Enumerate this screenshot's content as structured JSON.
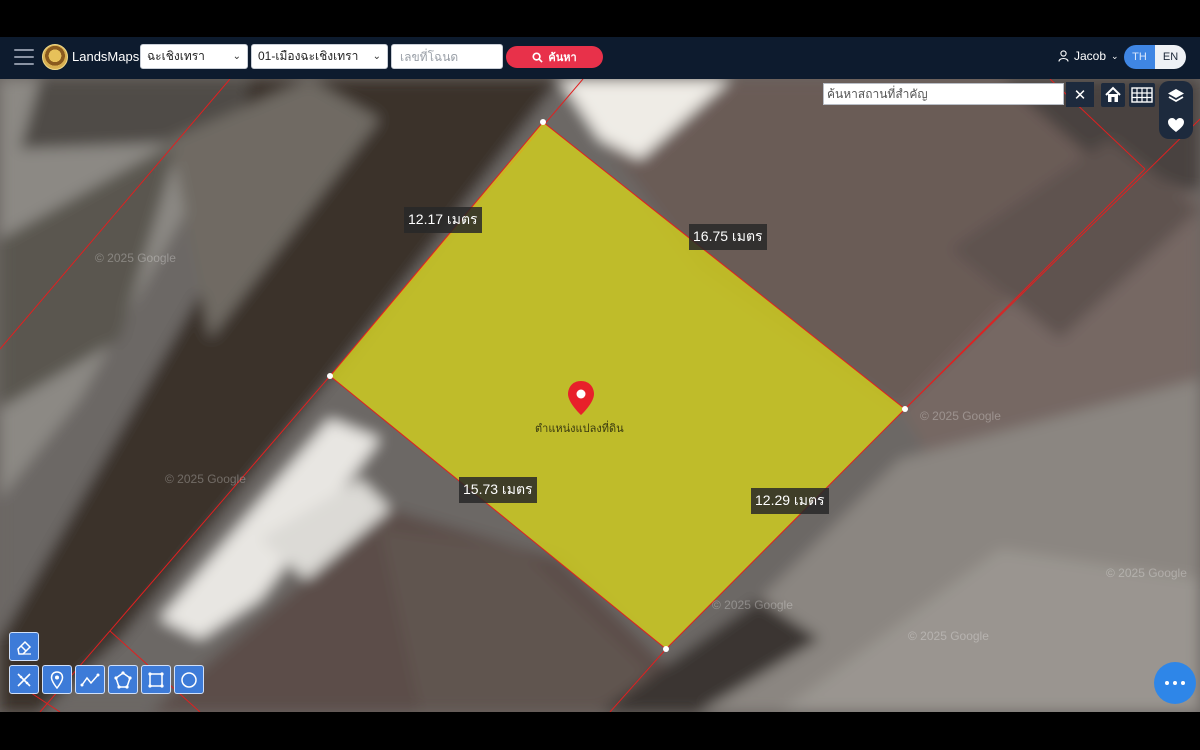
{
  "header": {
    "brand": "LandsMaps",
    "province_select": "ฉะเชิงเทรา",
    "district_select": "01-เมืองฉะเชิงเทรา",
    "parcel_placeholder": "เลขที่โฉนด",
    "search_label": "ค้นหา",
    "user_name": "Jacob",
    "lang_th": "TH",
    "lang_en": "EN"
  },
  "map": {
    "place_search_placeholder": "ค้นหาสถานที่สำคัญ",
    "close_label": "✕",
    "parcel_label": "ตำแหน่งแปลงที่ดิน",
    "dimensions": {
      "top_left": "12.17 เมตร",
      "top_right": "16.75 เมตร",
      "bottom_left": "15.73 เมตร",
      "bottom_right": "12.29 เมตร"
    },
    "watermark": "© 2025 Google",
    "parcel_fill": "#d4d418",
    "boundary_color": "#e02020",
    "pin_color": "#e8202a"
  },
  "tools": {
    "icons": [
      "eraser-icon",
      "measure-icon",
      "marker-icon",
      "polyline-icon",
      "polygon-icon",
      "rectangle-icon",
      "circle-icon"
    ]
  }
}
